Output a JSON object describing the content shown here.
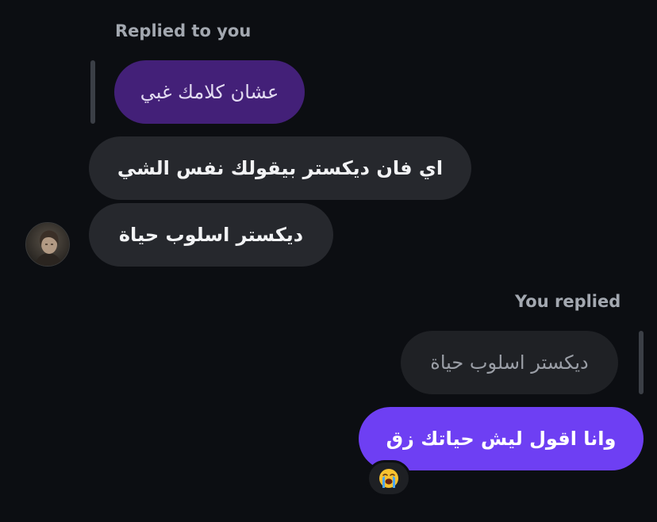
{
  "thread": {
    "incoming_reply_note": "Replied to you",
    "incoming_quoted_text": "عشان كلامك غبي",
    "incoming_messages": [
      "اي فان ديكستر بيقولك نفس الشي",
      "ديكستر اسلوب حياة"
    ],
    "outgoing_reply_note": "You replied",
    "outgoing_quoted_text": "ديكستر اسلوب حياة",
    "outgoing_message": "وانا اقول ليش حياتك زق",
    "reaction_emoji": "loudly-crying-face"
  },
  "colors": {
    "background": "#0c0e12",
    "incoming_bubble": "#26282d",
    "outgoing_bubble": "#6e3ff3",
    "quoted_own_bubble": "#432078",
    "quoted_other_bubble": "#1f2125",
    "meta_text": "#a3a8b0"
  }
}
